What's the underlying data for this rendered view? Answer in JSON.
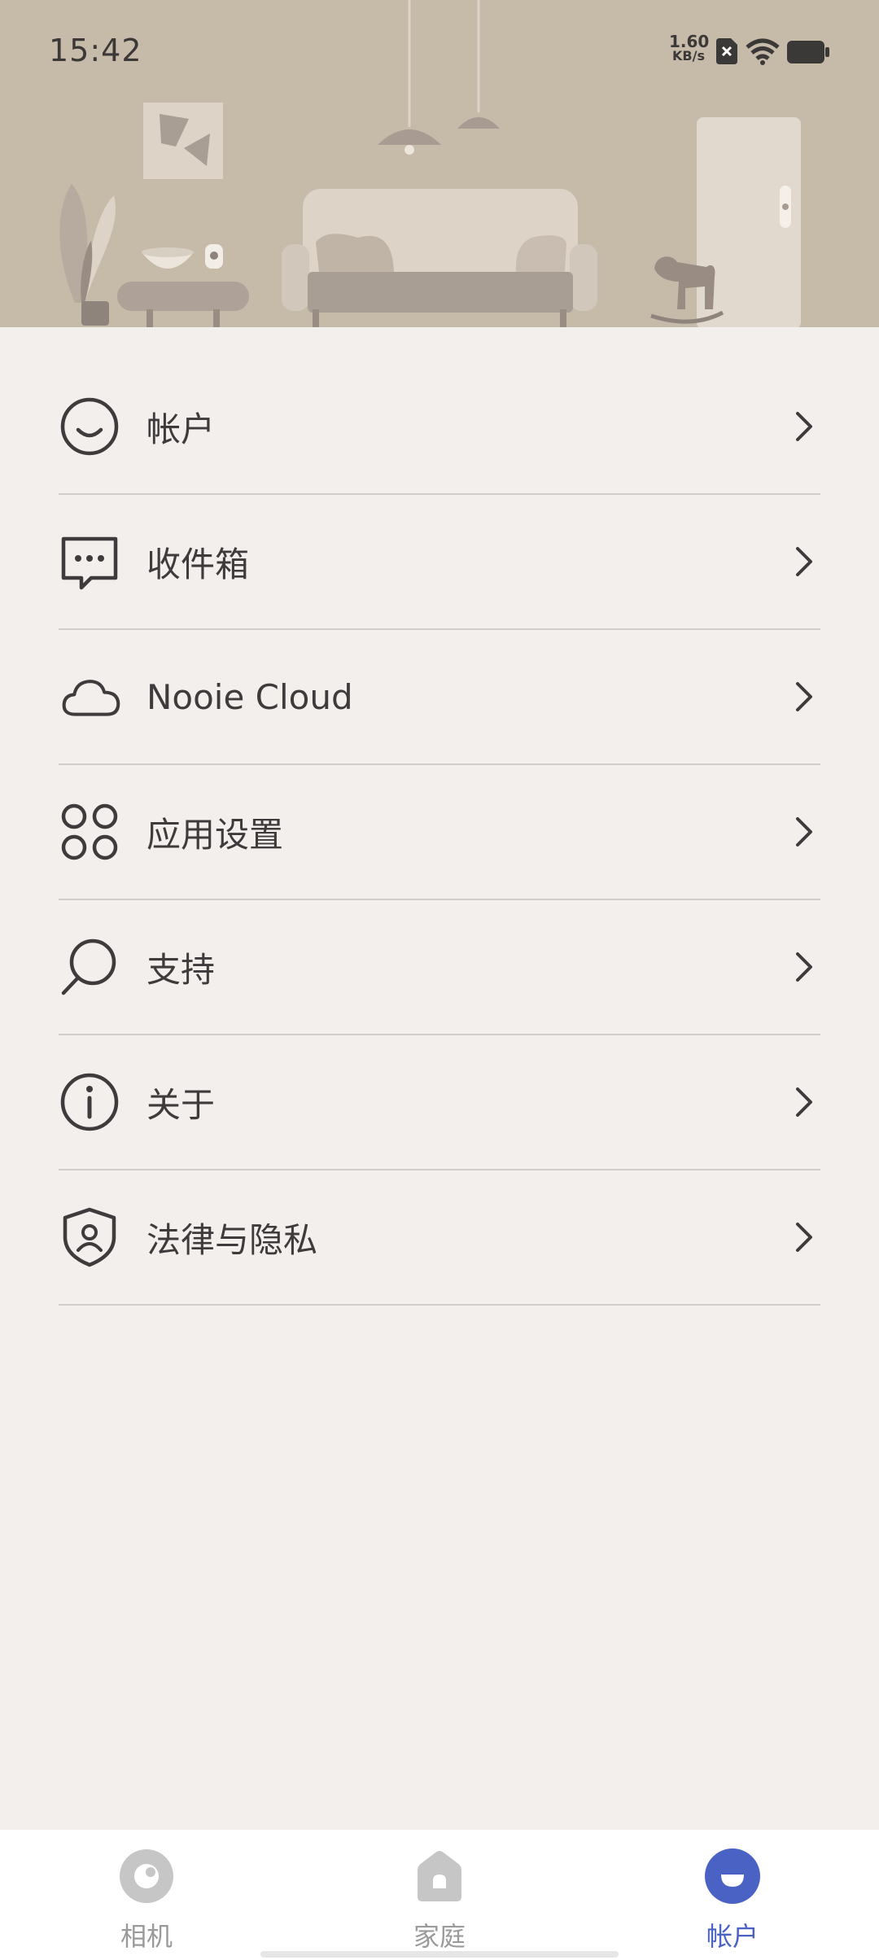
{
  "status_bar": {
    "time": "15:42",
    "net_speed_value": "1.60",
    "net_speed_unit": "KB/s",
    "icons": [
      "sim-off-icon",
      "wifi-icon",
      "battery-icon"
    ]
  },
  "header": {
    "illustration": "living-room-illustration"
  },
  "menu": {
    "items": [
      {
        "label": "帐户",
        "icon": "smile-face-icon"
      },
      {
        "label": "收件箱",
        "icon": "message-bubble-icon"
      },
      {
        "label": "Nooie Cloud",
        "icon": "cloud-icon"
      },
      {
        "label": "应用设置",
        "icon": "four-circles-icon"
      },
      {
        "label": "支持",
        "icon": "search-icon"
      },
      {
        "label": "关于",
        "icon": "info-icon"
      },
      {
        "label": "法律与隐私",
        "icon": "shield-user-icon"
      }
    ]
  },
  "tabbar": {
    "tabs": [
      {
        "label": "相机",
        "icon": "camera-lens-icon",
        "active": false
      },
      {
        "label": "家庭",
        "icon": "home-icon",
        "active": false
      },
      {
        "label": "帐户",
        "icon": "account-icon",
        "active": true
      }
    ]
  },
  "colors": {
    "background": "#f2efec",
    "header": "#c6baa9",
    "active_tab": "#4a62c4",
    "inactive_tab": "#9a9a9a",
    "divider": "#d0cdca"
  }
}
